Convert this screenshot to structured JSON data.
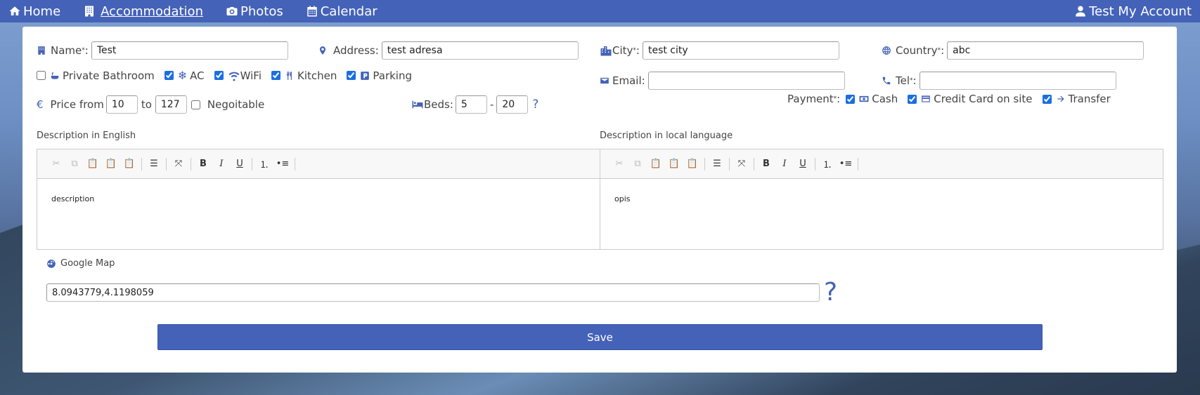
{
  "nav": {
    "home": "Home",
    "accommodation": "Accommodation",
    "photos": "Photos",
    "calendar": "Calendar",
    "account": "Test My Account"
  },
  "form": {
    "name_label": "Name",
    "name_value": "Test",
    "address_label": "Address:",
    "address_value": "test adresa",
    "city_label": "City",
    "city_value": "test city",
    "country_label": "Country",
    "country_value": "abc",
    "required_marker": "*",
    "colon": ":",
    "amenities": [
      {
        "label": "Private Bathroom",
        "checked": false
      },
      {
        "label": "AC",
        "checked": true
      },
      {
        "label": "WiFi",
        "checked": true
      },
      {
        "label": "Kitchen",
        "checked": true
      },
      {
        "label": "Parking",
        "checked": true
      }
    ],
    "email_label": "Email:",
    "email_value": "",
    "tel_label": "Tel",
    "tel_value": "",
    "price_from_label": "Price from",
    "price_from_value": "10",
    "price_to_label": "to",
    "price_to_value": "127",
    "negotiable_label": "Negoitable",
    "beds_label": "Beds:",
    "beds_min": "5",
    "beds_dash": "-",
    "beds_max": "20",
    "help_mark": "?",
    "payment_label": "Payment",
    "payments": [
      {
        "label": "Cash",
        "checked": true
      },
      {
        "label": "Credit Card on site",
        "checked": true
      },
      {
        "label": "Transfer",
        "checked": true
      }
    ],
    "desc_en_label": "Description in English",
    "desc_en_value": "description",
    "desc_local_label": "Description in local language",
    "desc_local_value": "opis",
    "map_label": "Google Map",
    "map_value": "8.0943779,4.1198059",
    "save_label": "Save"
  }
}
